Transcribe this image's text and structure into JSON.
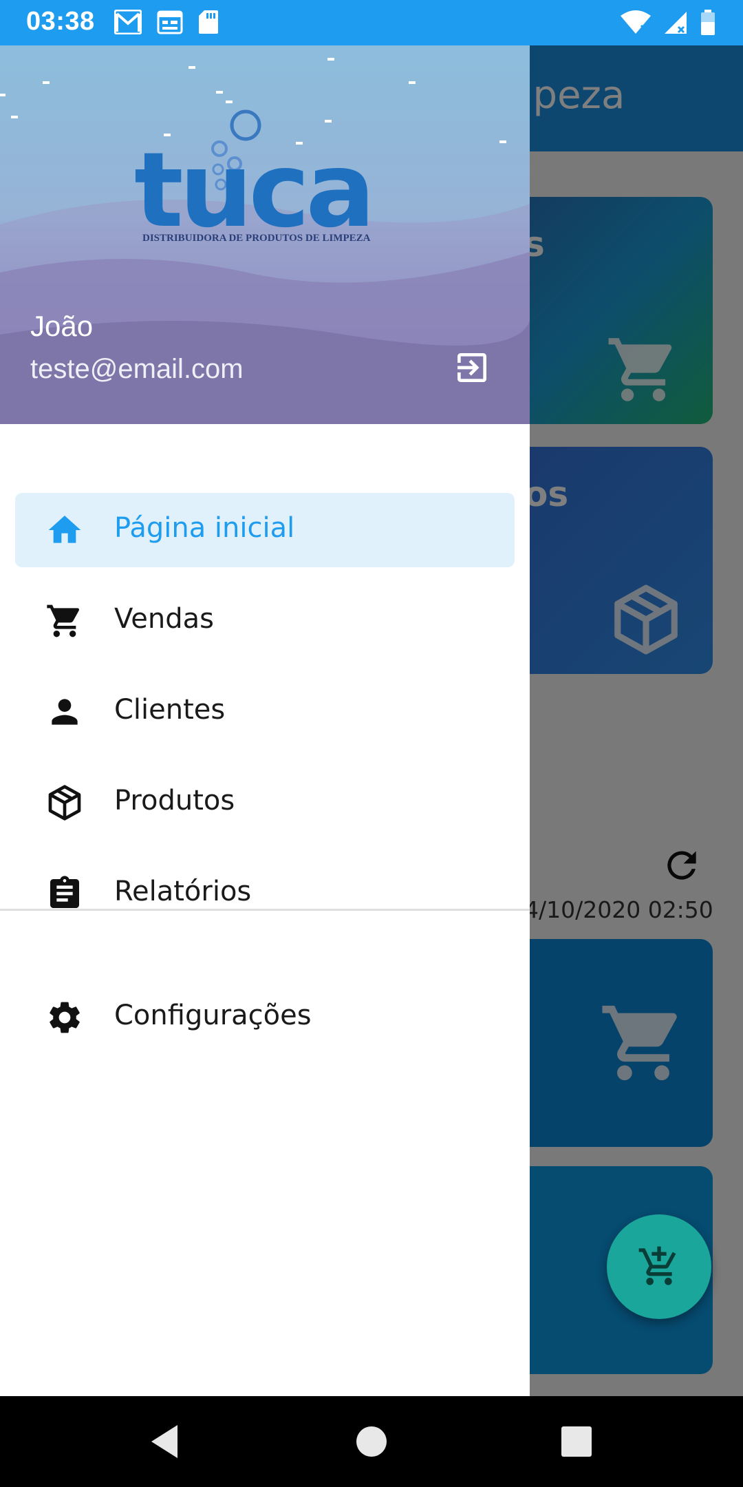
{
  "status_bar": {
    "time": "03:38",
    "left_icons": [
      "gmail-icon",
      "calendar-icon",
      "sd-card-icon"
    ],
    "right_icons": [
      "wifi-icon",
      "signal-icon",
      "battery-icon"
    ]
  },
  "background_app": {
    "title_partial": "mpeza",
    "cards": [
      {
        "label_partial": "s",
        "icon": "cart-icon"
      },
      {
        "label_partial": "os",
        "icon": "box-icon"
      }
    ],
    "timestamp_partial": "4/10/2020 02:50",
    "fab_icon": "add-to-cart-icon"
  },
  "drawer": {
    "brand": {
      "logo_text": "tuca",
      "logo_subtitle": "DISTRIBUIDORA DE PRODUTOS DE LIMPEZA"
    },
    "user": {
      "name": "João",
      "email": "teste@email.com"
    },
    "menu": [
      {
        "label": "Página inicial",
        "icon": "home-icon",
        "active": true
      },
      {
        "label": "Vendas",
        "icon": "cart-icon",
        "active": false
      },
      {
        "label": "Clientes",
        "icon": "person-icon",
        "active": false
      },
      {
        "label": "Produtos",
        "icon": "box-icon",
        "active": false
      },
      {
        "label": "Relatórios",
        "icon": "clipboard-icon",
        "active": false
      }
    ],
    "secondary_menu": [
      {
        "label": "Configurações",
        "icon": "gear-icon",
        "active": false
      }
    ]
  },
  "colors": {
    "accent": "#1e9cf0",
    "active_bg": "#e1f1fc",
    "fab": "#1aa69a"
  }
}
